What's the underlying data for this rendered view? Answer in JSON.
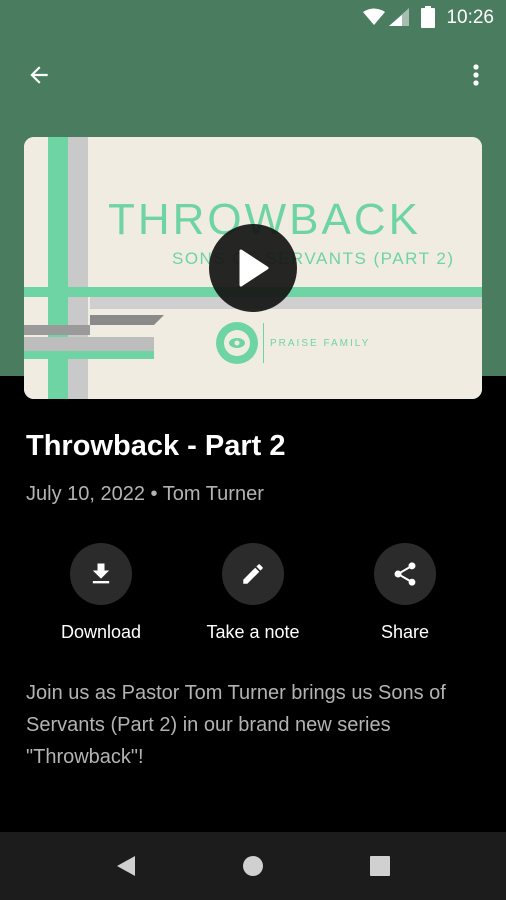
{
  "status_bar": {
    "time": "10:26"
  },
  "colors": {
    "header_bg": "#4a7c60",
    "accent_green": "#6fd4a4",
    "background": "#000000"
  },
  "thumbnail": {
    "title": "THROWBACK",
    "subtitle": "SONS OF SERVANTS (PART 2)",
    "brand": "PRAISE FAMILY"
  },
  "sermon": {
    "title": "Throwback - Part 2",
    "meta": "July 10, 2022 • Tom Turner",
    "description": "Join us as Pastor Tom Turner brings us Sons of Servants (Part 2) in our brand new series \"Throwback\"!"
  },
  "actions": [
    {
      "label": "Download",
      "icon": "download-icon"
    },
    {
      "label": "Take a note",
      "icon": "pencil-icon"
    },
    {
      "label": "Share",
      "icon": "share-icon"
    }
  ],
  "icons": {
    "back": "arrow-left-icon",
    "more": "more-vert-icon",
    "play": "play-icon"
  }
}
